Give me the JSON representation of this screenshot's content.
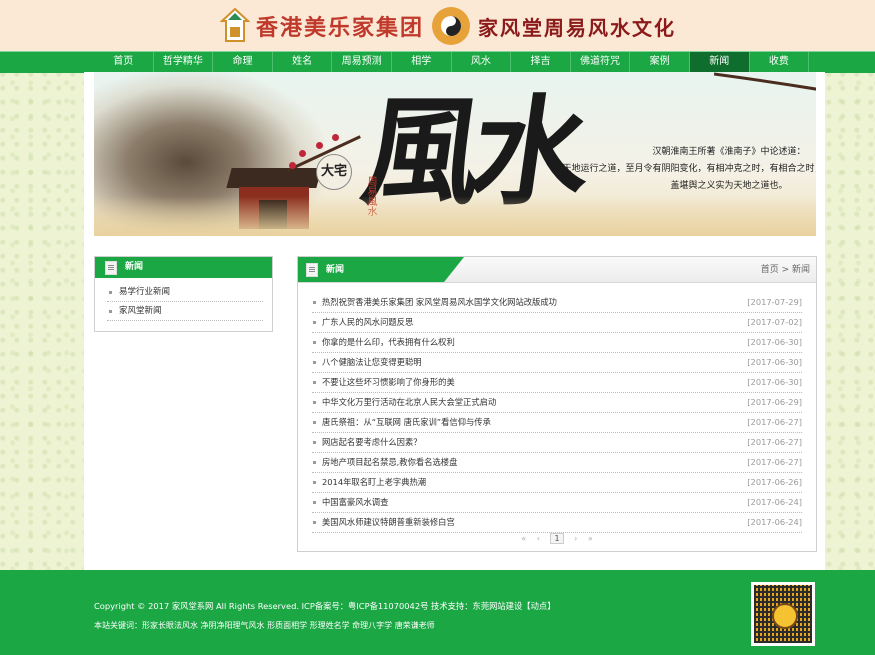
{
  "header": {
    "title_left": "香港美乐家集团",
    "title_right": "家风堂周易风水文化"
  },
  "nav": {
    "items": [
      "首页",
      "哲学精华",
      "命理",
      "姓名",
      "周易预测",
      "相学",
      "风水",
      "择吉",
      "佛道符咒",
      "案例",
      "新闻",
      "收费"
    ],
    "active_index": 10
  },
  "banner": {
    "calligraphy": "風水",
    "seal_big": "大宅",
    "seal_small": "周易風水",
    "quote_lines": [
      "汉朝淮南王所著《淮南子》中论述道：",
      "天地运行之道，至月令有阴阳变化，有相冲克之时，有相合之时，前者凶，后者吉。",
      "盖堪舆之义实为天地之道也。"
    ]
  },
  "sidebar": {
    "title": "新闻",
    "items": [
      "易学行业新闻",
      "家风堂新闻"
    ]
  },
  "main": {
    "title": "新闻",
    "breadcrumb": "首页 > 新闻",
    "news": [
      {
        "title": "热烈祝贺香港美乐家集团 家风堂周易风水国学文化网站改版成功",
        "date": "[2017-07-29]"
      },
      {
        "title": "广东人民的风水问题反思",
        "date": "[2017-07-02]"
      },
      {
        "title": "你拿的是什么印，代表拥有什么权利",
        "date": "[2017-06-30]"
      },
      {
        "title": "八个健脑法让您变得更聪明",
        "date": "[2017-06-30]"
      },
      {
        "title": "不要让这些坏习惯影响了你身形的美",
        "date": "[2017-06-30]"
      },
      {
        "title": "中华文化万里行活动在北京人民大会堂正式启动",
        "date": "[2017-06-29]"
      },
      {
        "title": "唐氏祭祖：从“互联网 唐氏家训”看信仰与传承",
        "date": "[2017-06-27]"
      },
      {
        "title": "网店起名要考虑什么因素？",
        "date": "[2017-06-27]"
      },
      {
        "title": "房地产项目起名禁忌,教你看名选楼盘",
        "date": "[2017-06-27]"
      },
      {
        "title": "2014年取名盯上老字典热潮",
        "date": "[2017-06-26]"
      },
      {
        "title": "中国富豪风水调查",
        "date": "[2017-06-24]"
      },
      {
        "title": "美国风水师建议特朗普重新装修白宫",
        "date": "[2017-06-24]"
      }
    ],
    "pager": {
      "first": "«",
      "prev": "‹",
      "current": "1",
      "next": "›",
      "last": "»"
    }
  },
  "footer": {
    "copyright": "Copyright © 2017 家风堂系网 All Rights Reserved.   ICP备案号：粤ICP备11070042号   技术支持：东莞网站建设【动点】",
    "keywords": "本站关键词：形家长眼法风水 净阴净阳理气风水 形质面相学 形理姓名学 命理八字学 唐荣谦老师"
  },
  "colors": {
    "brand_green": "#1aa744",
    "nav_active": "#0f6e2d",
    "header_bg": "#fbe9d6"
  }
}
